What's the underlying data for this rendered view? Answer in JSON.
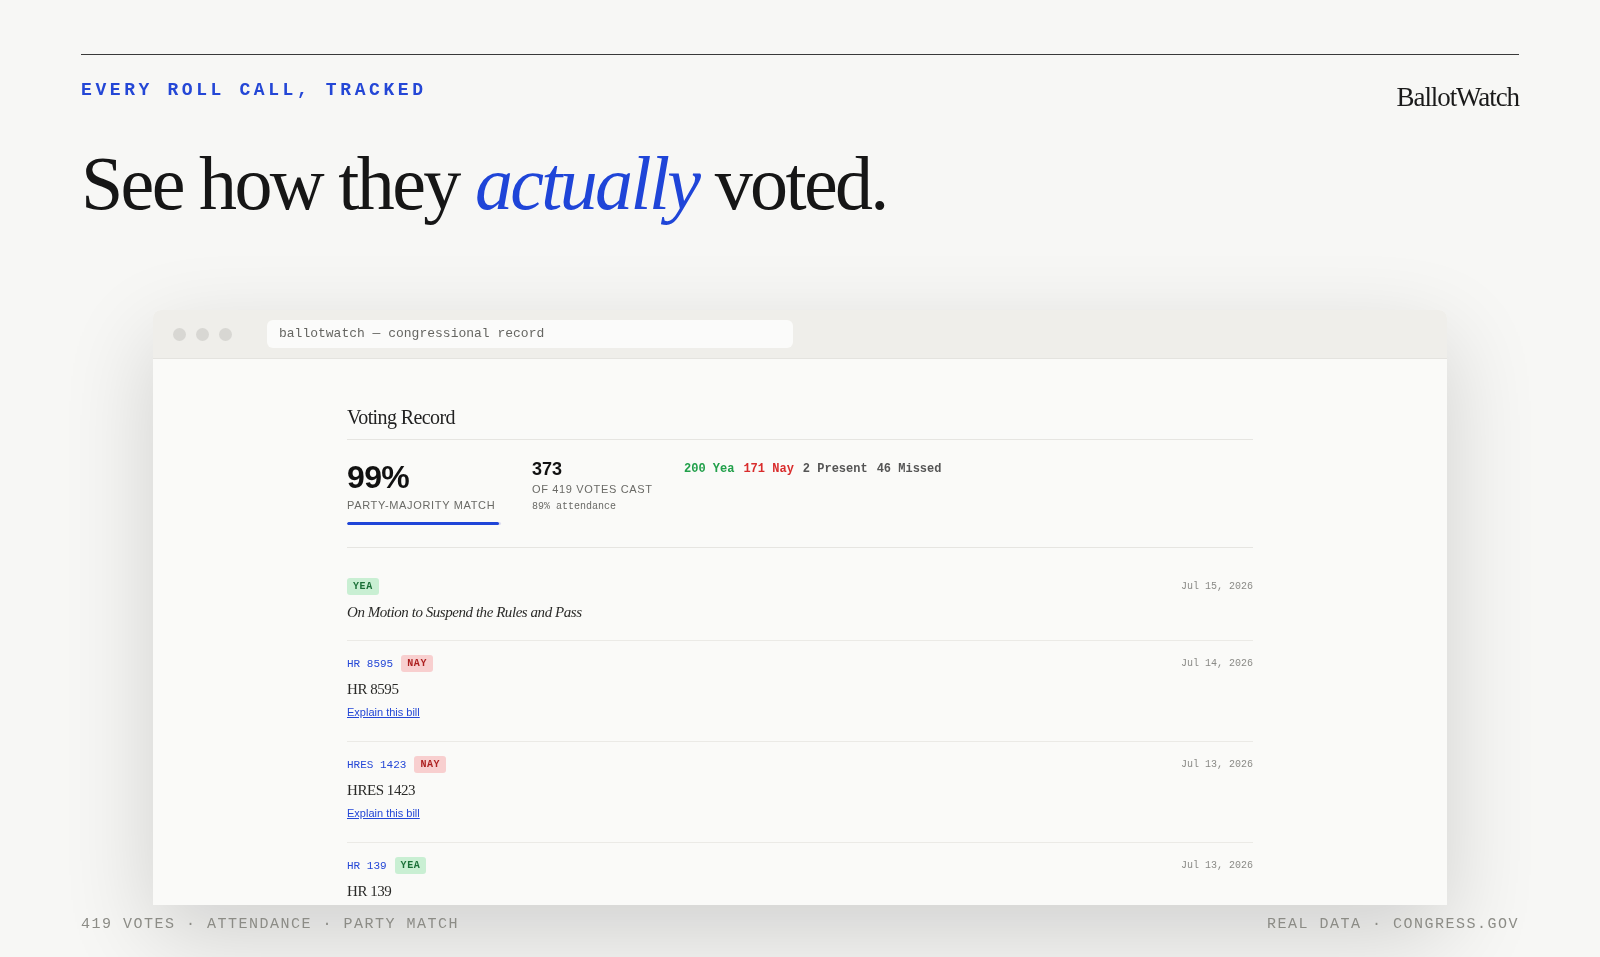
{
  "header": {
    "eyebrow": "EVERY ROLL CALL, TRACKED",
    "logo": "BallotWatch",
    "headline": "See how they *actually* voted."
  },
  "window": {
    "address": "ballotwatch — congressional record",
    "section_title": "Voting Record",
    "summary": {
      "match": {
        "value": "99%",
        "label": "PARTY-MAJORITY MATCH",
        "level": 0.99
      },
      "cast": {
        "value": "373",
        "label": "OF 419 VOTES CAST",
        "note": "89% attendance"
      },
      "counts": [
        {
          "text": "200 Yea",
          "color": "#22a04b"
        },
        {
          "text": "171 Nay",
          "color": "#d92c2c"
        },
        {
          "text": "2 Present",
          "color": "#555555"
        },
        {
          "text": "46 Missed",
          "color": "#555555"
        }
      ]
    },
    "votes": [
      {
        "kind": "motion",
        "vote": {
          "text": "YEA",
          "kind": "yea"
        },
        "date": "Jul 15, 2026",
        "title": "On Motion to Suspend the Rules and Pass"
      },
      {
        "kind": "bill",
        "code": "HR 8595",
        "vote": {
          "text": "NAY",
          "kind": "nay"
        },
        "date": "Jul 14, 2026",
        "title": "HR 8595",
        "link": "Explain this bill"
      },
      {
        "kind": "bill",
        "code": "HRES 1423",
        "vote": {
          "text": "NAY",
          "kind": "nay"
        },
        "date": "Jul 13, 2026",
        "title": "HRES 1423",
        "link": "Explain this bill"
      },
      {
        "kind": "bill",
        "code": "HR 139",
        "vote": {
          "text": "YEA",
          "kind": "yea"
        },
        "date": "Jul 13, 2026",
        "title": "HR 139"
      }
    ]
  },
  "footer": {
    "left": "419 VOTES · ATTENDANCE · PARTY MATCH",
    "right": "REAL DATA · CONGRESS.GOV"
  }
}
